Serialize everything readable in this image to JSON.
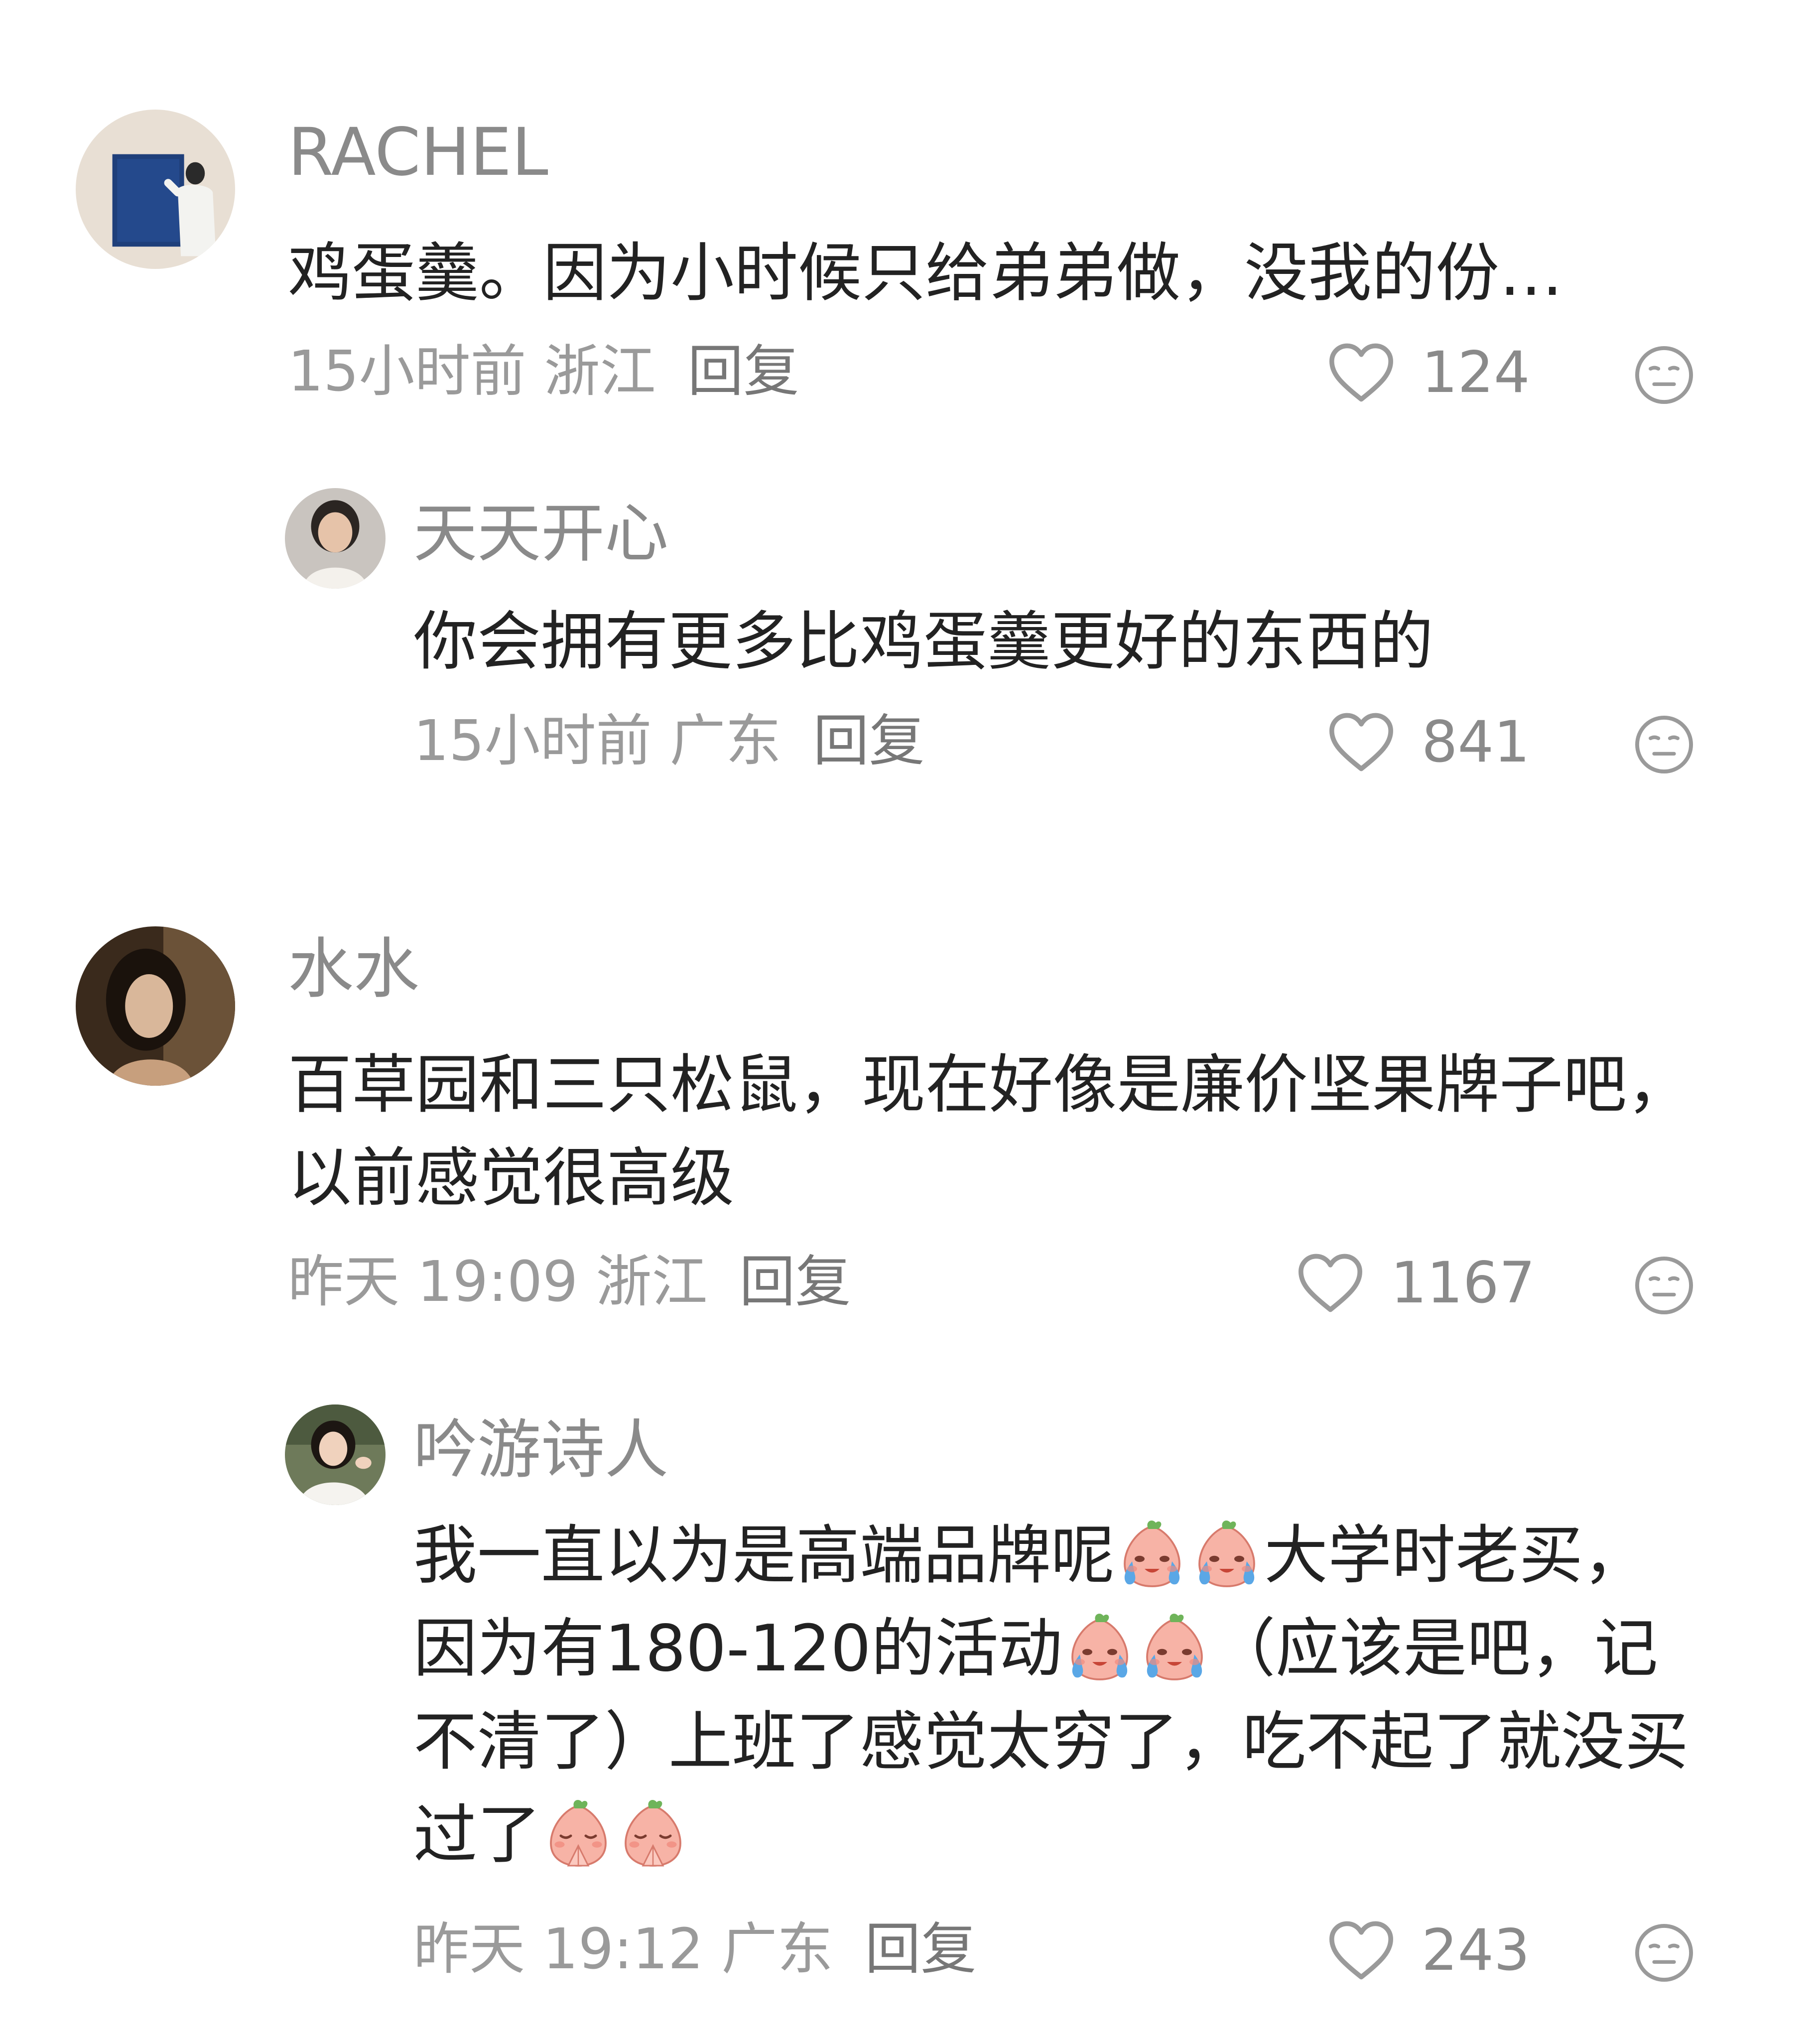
{
  "comments": [
    {
      "user": "RACHEL",
      "text": "鸡蛋羹。因为小时候只给弟弟做，没我的份…",
      "time": "15小时前",
      "location": "浙江",
      "reply_label": "回复",
      "likes": "124",
      "avatar": "blue-painting-avatar"
    },
    {
      "user": "天天开心",
      "text": "你会拥有更多比鸡蛋羹更好的东西的",
      "time": "15小时前",
      "location": "广东",
      "reply_label": "回复",
      "likes": "841",
      "avatar": "woman-portrait-avatar"
    },
    {
      "user": "水水",
      "text": "百草园和三只松鼠，现在好像是廉价坚果牌子吧，以前感觉很高级",
      "time": "昨天 19:09",
      "location": "浙江",
      "reply_label": "回复",
      "likes": "1167",
      "avatar": "woman-dark-avatar"
    },
    {
      "user": "吟游诗人",
      "text_parts": [
        "我一直以为是高端品牌呢",
        "大学时老买，因为有180-120的活动",
        "（应该是吧，记不清了）上班了感觉太穷了，吃不起了就没买过了"
      ],
      "time": "昨天 19:12",
      "location": "广东",
      "reply_label": "回复",
      "likes": "243",
      "avatar": "woman-white-avatar",
      "emojis": [
        "crying-peach-emoji",
        "crying-peach-emoji",
        "crying-peach-emoji",
        "crying-peach-emoji",
        "praying-peach-emoji",
        "praying-peach-emoji"
      ]
    }
  ],
  "icons": {
    "like": "heart-outline-icon",
    "dislike": "meh-face-icon"
  }
}
